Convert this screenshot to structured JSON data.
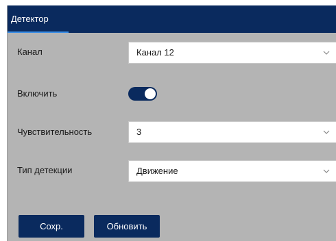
{
  "header": {
    "title": "Детектор"
  },
  "form": {
    "channel": {
      "label": "Канал",
      "value": "Канал 12"
    },
    "enable": {
      "label": "Включить",
      "on": true
    },
    "sensitivity": {
      "label": "Чувствительность",
      "value": "3"
    },
    "detection_type": {
      "label": "Тип детекции",
      "value": "Движение"
    }
  },
  "buttons": {
    "save_label": "Сохр.",
    "refresh_label": "Обновить"
  },
  "colors": {
    "accent": "#0a2a5e",
    "tab_underline": "#3a8ee6",
    "panel_bg": "#b4b4b4"
  }
}
